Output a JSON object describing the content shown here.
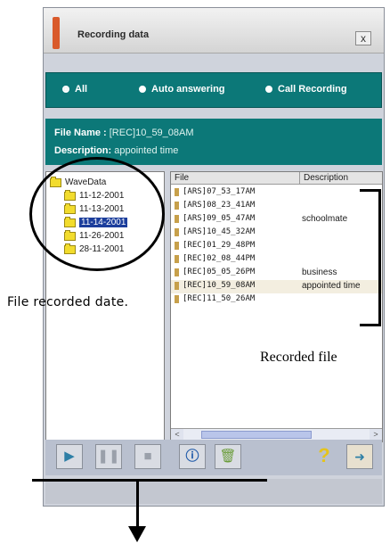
{
  "window": {
    "title": "Recording data",
    "close_label": "x"
  },
  "filter": {
    "options": [
      {
        "label": "All",
        "selected": true
      },
      {
        "label": "Auto answering",
        "selected": false
      },
      {
        "label": "Call Recording",
        "selected": false
      }
    ]
  },
  "file_info": {
    "name_label": "File Name :",
    "name_value": "[REC]10_59_08AM",
    "description_label": "Description:",
    "description_value": "appointed time"
  },
  "tree": {
    "root": "WaveData",
    "items": [
      {
        "label": "11-12-2001",
        "selected": false
      },
      {
        "label": "11-13-2001",
        "selected": false
      },
      {
        "label": "11-14-2001",
        "selected": true
      },
      {
        "label": "11-26-2001",
        "selected": false
      },
      {
        "label": "28-11-2001",
        "selected": false
      }
    ]
  },
  "list": {
    "headers": {
      "file": "File",
      "description": "Description"
    },
    "rows": [
      {
        "file": "[ARS]07_53_17AM",
        "description": ""
      },
      {
        "file": "[ARS]08_23_41AM",
        "description": ""
      },
      {
        "file": "[ARS]09_05_47AM",
        "description": "schoolmate"
      },
      {
        "file": "[ARS]10_45_32AM",
        "description": ""
      },
      {
        "file": "[REC]01_29_48PM",
        "description": ""
      },
      {
        "file": "[REC]02_08_44PM",
        "description": ""
      },
      {
        "file": "[REC]05_05_26PM",
        "description": "business"
      },
      {
        "file": "[REC]10_59_08AM",
        "description": "appointed time",
        "selected": true
      },
      {
        "file": "[REC]11_50_26AM",
        "description": ""
      }
    ]
  },
  "scrollbar": {
    "left_arrow": "<",
    "right_arrow": ">"
  },
  "toolbar": {
    "play_icon": "play-icon",
    "pause_icon": "pause-icon",
    "stop_icon": "stop-icon",
    "help_icon": "help-icon",
    "delete_icon": "delete-icon",
    "question_icon": "question-icon",
    "exit_icon": "exit-icon",
    "question_glyph": "?"
  },
  "annotations": {
    "left_label": "File recorded date.",
    "right_label": "Recorded file"
  }
}
